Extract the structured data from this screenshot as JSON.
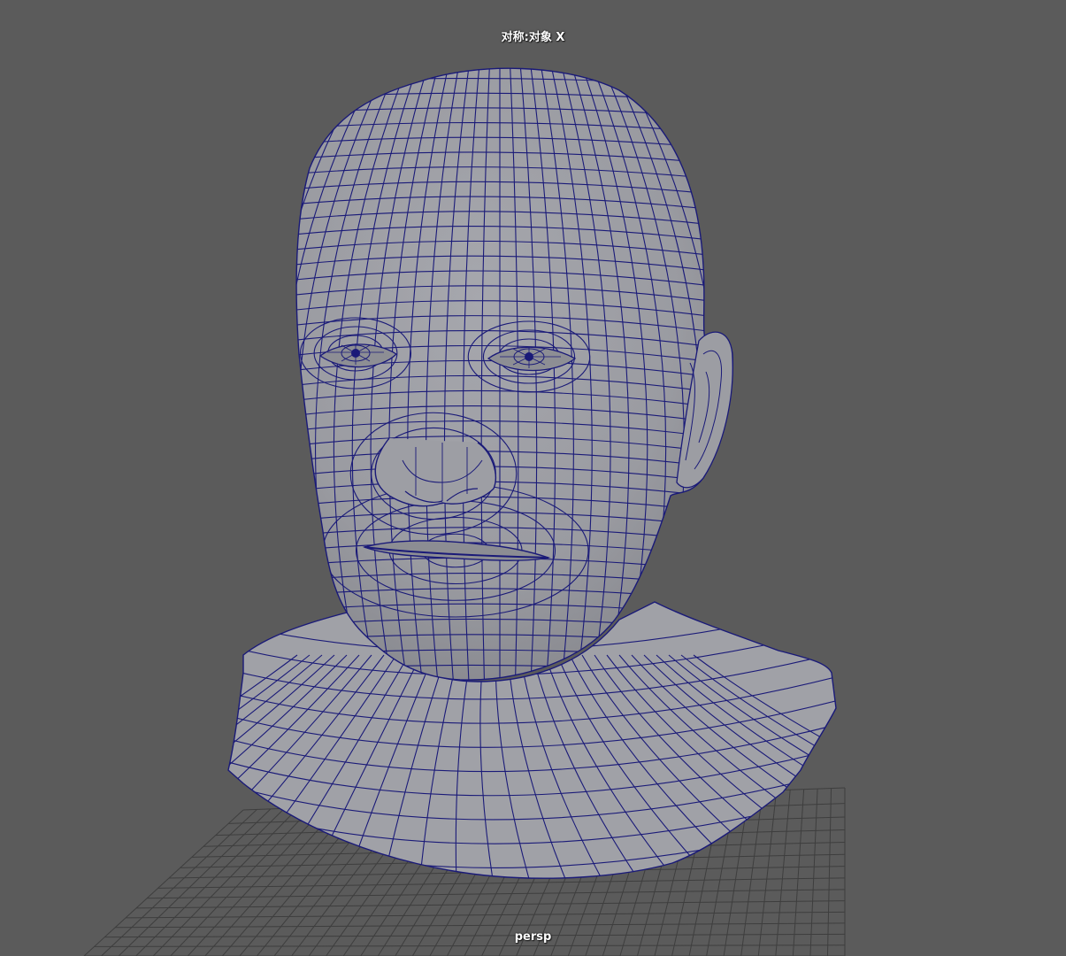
{
  "viewport": {
    "symmetry_label": "对称:对象 X",
    "camera_label": "persp"
  },
  "colors": {
    "background": "#5b5b5b",
    "mesh_fill": "#999aa0",
    "wireframe": "#1a1a78",
    "grid": "#3e3e3e",
    "hud_text": "#ffffff"
  },
  "scene": {
    "object": "head-bust-mesh",
    "display_mode": "wireframe-on-shaded",
    "grid_visible": true
  }
}
